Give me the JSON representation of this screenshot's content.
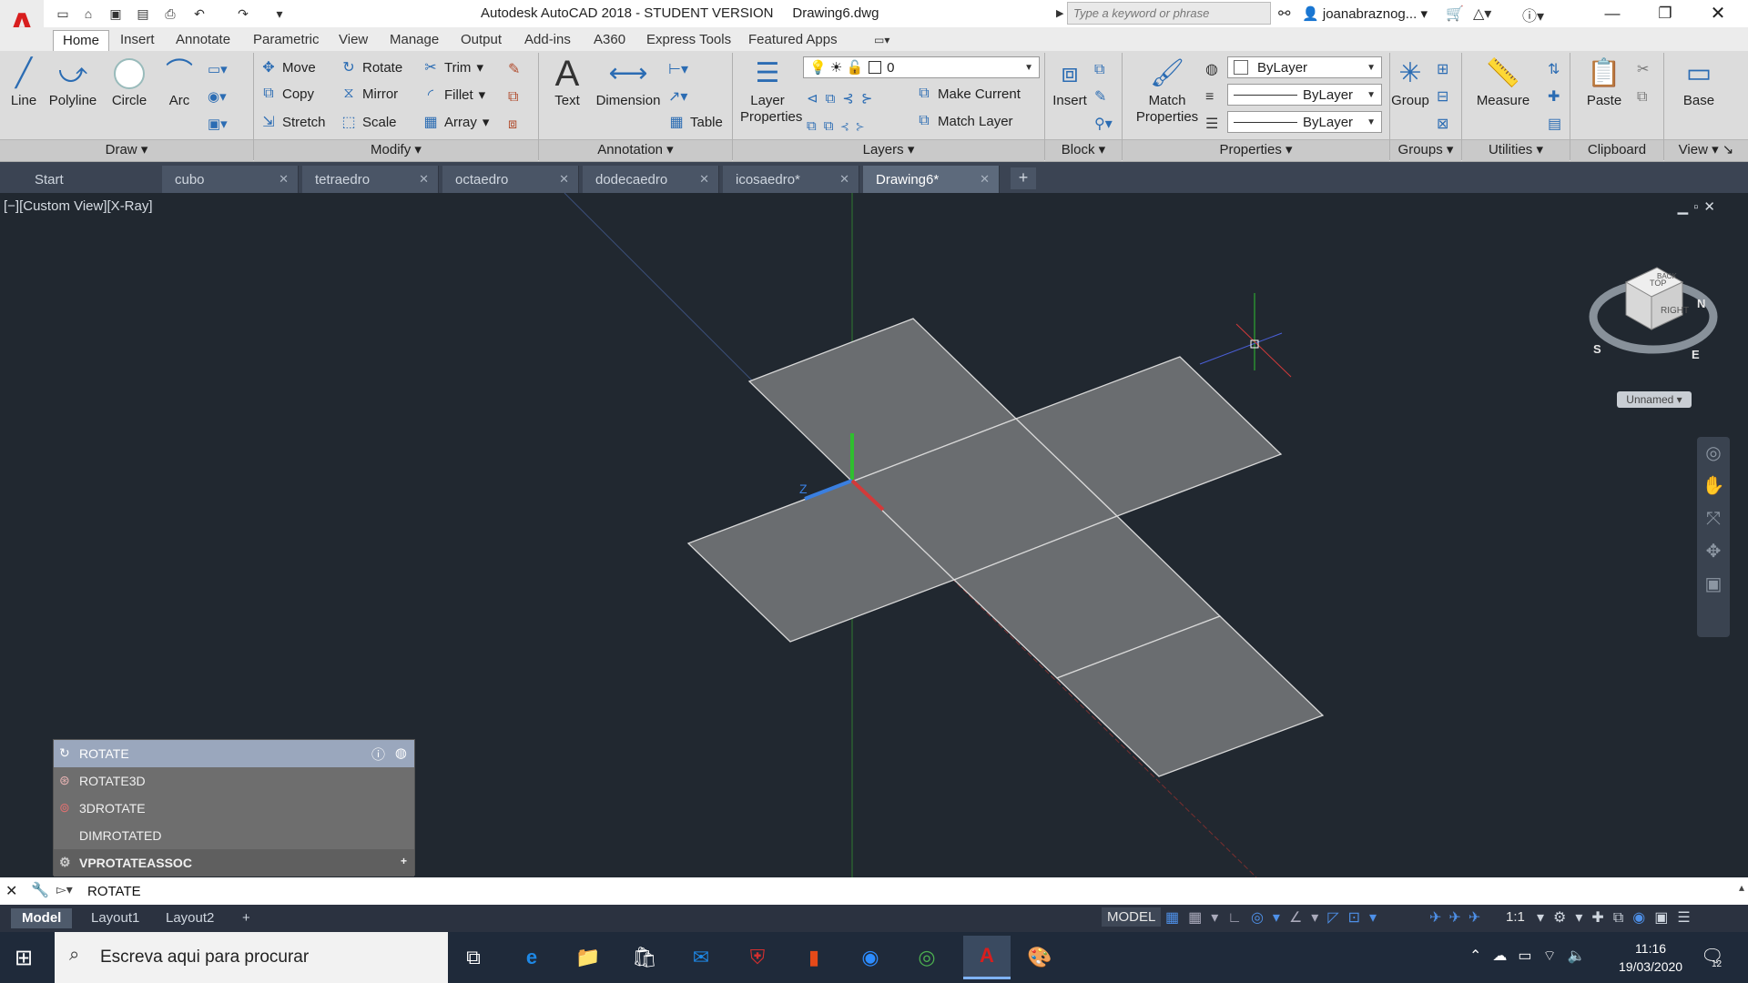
{
  "titlebar": {
    "app_title": "Autodesk AutoCAD 2018 - STUDENT VERSION",
    "drawing_name": "Drawing6.dwg",
    "search_placeholder": "Type a keyword or phrase",
    "user": "joanabraznog..."
  },
  "ribbon_tabs": [
    "Home",
    "Insert",
    "Annotate",
    "Parametric",
    "View",
    "Manage",
    "Output",
    "Add-ins",
    "A360",
    "Express Tools",
    "Featured Apps"
  ],
  "ribbon": {
    "draw": {
      "line": "Line",
      "polyline": "Polyline",
      "circle": "Circle",
      "arc": "Arc",
      "panel": "Draw"
    },
    "modify": {
      "move": "Move",
      "rotate": "Rotate",
      "trim": "Trim",
      "copy": "Copy",
      "mirror": "Mirror",
      "fillet": "Fillet",
      "stretch": "Stretch",
      "scale": "Scale",
      "array": "Array",
      "panel": "Modify"
    },
    "annotation": {
      "text": "Text",
      "dimension": "Dimension",
      "table": "Table",
      "panel": "Annotation"
    },
    "layers": {
      "layer_properties": "Layer Properties",
      "current_layer": "0",
      "make_current": "Make Current",
      "match_layer": "Match Layer",
      "panel": "Layers"
    },
    "block": {
      "insert": "Insert",
      "panel": "Block"
    },
    "properties": {
      "match_properties": "Match Properties",
      "color": "ByLayer",
      "linetype": "ByLayer",
      "lineweight": "ByLayer",
      "panel": "Properties"
    },
    "groups": {
      "group": "Group",
      "panel": "Groups"
    },
    "utilities": {
      "measure": "Measure",
      "panel": "Utilities"
    },
    "clipboard": {
      "paste": "Paste",
      "panel": "Clipboard"
    },
    "view": {
      "base": "Base",
      "panel": "View"
    }
  },
  "doc_tabs": [
    {
      "label": "Start"
    },
    {
      "label": "cubo"
    },
    {
      "label": "tetraedro"
    },
    {
      "label": "octaedro"
    },
    {
      "label": "dodecaedro"
    },
    {
      "label": "icosaedro*"
    },
    {
      "label": "Drawing6*"
    }
  ],
  "viewport": {
    "label": "[−][Custom View][X-Ray]",
    "ucs_axis_label": "Z",
    "viewcube": {
      "top": "TOP",
      "face": "RIGHT",
      "back": "BACK",
      "compass_n": "N",
      "compass_s": "S",
      "compass_e": "E",
      "named_view": "Unnamed"
    }
  },
  "autocomplete": {
    "items": [
      "ROTATE",
      "ROTATE3D",
      "3DROTATE",
      "DIMROTATED",
      "VPROTATEASSOC"
    ],
    "selected": "ROTATE"
  },
  "command_line": {
    "text": "ROTATE"
  },
  "layout_tabs": [
    "Model",
    "Layout1",
    "Layout2"
  ],
  "status": {
    "space": "MODEL",
    "scale": "1:1"
  },
  "taskbar": {
    "search_placeholder": "Escreva aqui para procurar",
    "time": "11:16",
    "date": "19/03/2020",
    "notifications": "12"
  },
  "colors": {
    "viewport_bg": "#212830",
    "net_fill": "#6a6d70",
    "ribbon_bg": "#dcdcdc",
    "accent": "#2b6cb3"
  }
}
